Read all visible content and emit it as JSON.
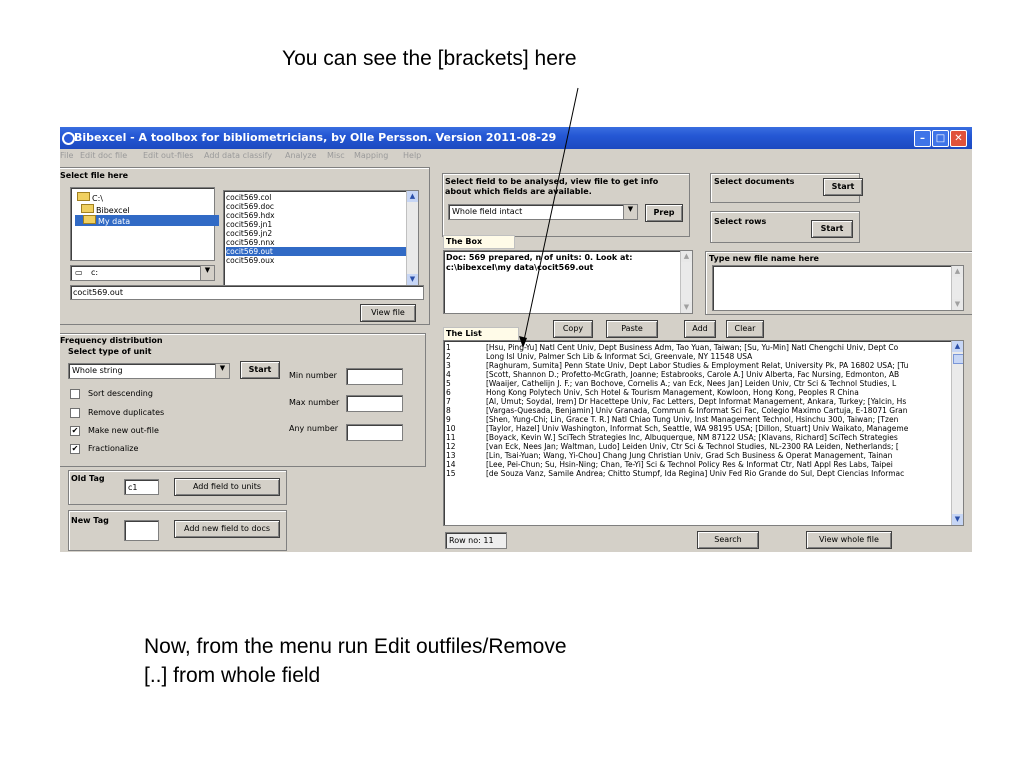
{
  "slide": {
    "top_caption": "You can see the [brackets] here",
    "bottom_caption_line1": "Now, from the menu run Edit outfiles/Remove",
    "bottom_caption_line2": "[..] from whole field"
  },
  "window": {
    "title": "Bibexcel - A toolbox for bibliometricians, by Olle Persson. Version 2011-08-29",
    "menu": [
      "File",
      "Edit doc file",
      "Edit out-files",
      "Add data classify",
      "Analyze",
      "Misc",
      "Mapping",
      "Help"
    ]
  },
  "select_file": {
    "label": "Select file here",
    "folders": [
      "C:\\",
      "Bibexcel",
      "My data"
    ],
    "files": [
      "cocit569.col",
      "cocit569.doc",
      "cocit569.hdx",
      "cocit569.jn1",
      "cocit569.jn2",
      "cocit569.nnx",
      "cocit569.out",
      "cocit569.oux"
    ],
    "selected_file": "cocit569.out",
    "drive": "c:",
    "path_value": "cocit569.out",
    "view_file_button": "View file"
  },
  "frequency": {
    "title": "Frequency distribution",
    "select_type_label": "Select type of unit",
    "unit_type": "Whole string",
    "start_button": "Start",
    "options": [
      {
        "label": "Sort descending",
        "checked": false
      },
      {
        "label": "Remove duplicates",
        "checked": false
      },
      {
        "label": "Make new out-file",
        "checked": true
      },
      {
        "label": "Fractionalize",
        "checked": true
      }
    ],
    "min_label": "Min number",
    "max_label": "Max number",
    "any_label": "Any number"
  },
  "old_tag": {
    "label": "Old Tag",
    "value": "c1",
    "button": "Add field to units"
  },
  "new_tag": {
    "label": "New Tag",
    "value": "",
    "button": "Add new field to docs"
  },
  "select_field": {
    "label_line1": "Select field to be analysed, view file to get info",
    "label_line2": "about which fields are available.",
    "field_value": "Whole field intact",
    "prep_button": "Prep"
  },
  "select_documents": {
    "label": "Select documents",
    "button": "Start"
  },
  "select_rows": {
    "label": "Select rows",
    "button": "Start"
  },
  "the_box": {
    "label": "The Box",
    "line1": "Doc: 569 prepared, n of units: 0. Look at:",
    "line2": "c:\\bibexcel\\my data\\cocit569.out"
  },
  "new_file": {
    "label": "Type new file name here",
    "value": ""
  },
  "the_list": {
    "label": "The List",
    "copy": "Copy",
    "paste": "Paste",
    "add": "Add",
    "clear": "Clear",
    "rows": [
      {
        "n": "1",
        "text": "[Hsu, Ping-Yu] Natl Cent Univ, Dept Business Adm, Tao Yuan, Taiwan; [Su, Yu-Min] Natl Chengchi Univ, Dept Co"
      },
      {
        "n": "2",
        "text": "Long Isl Univ, Palmer Sch Lib & Informat Sci, Greenvale, NY 11548 USA"
      },
      {
        "n": "3",
        "text": "[Raghuram, Sumita] Penn State Univ, Dept Labor Studies & Employment Relat, University Pk, PA 16802 USA; [Tu"
      },
      {
        "n": "4",
        "text": "[Scott, Shannon D.; Profetto-McGrath, Joanne; Estabrooks, Carole A.] Univ Alberta, Fac Nursing, Edmonton, AB"
      },
      {
        "n": "5",
        "text": "[Waaijer, Cathelijn J. F.; van Bochove, Cornelis A.; van Eck, Nees Jan] Leiden Univ, Ctr Sci & Technol Studies, L"
      },
      {
        "n": "6",
        "text": "Hong Kong Polytech Univ, Sch Hotel & Tourism Management, Kowloon, Hong Kong, Peoples R China"
      },
      {
        "n": "7",
        "text": "[Al, Umut; Soydal, Irem] Dr Hacettepe Univ, Fac Letters, Dept Informat Management, Ankara, Turkey; [Yalcin, Hs"
      },
      {
        "n": "8",
        "text": "[Vargas-Quesada, Benjamin] Univ Granada, Commun & Informat Sci Fac, Colegio Maximo Cartuja, E-18071 Gran"
      },
      {
        "n": "9",
        "text": "[Shen, Yung-Chi; Lin, Grace T. R.] Natl Chiao Tung Univ, Inst Management Technol, Hsinchu 300, Taiwan; [Tzen"
      },
      {
        "n": "10",
        "text": "[Taylor, Hazel] Univ Washington, Informat Sch, Seattle, WA 98195 USA; [Dillon, Stuart] Univ Waikato, Manageme"
      },
      {
        "n": "11",
        "text": "[Boyack, Kevin W.] SciTech Strategies Inc, Albuquerque, NM 87122 USA; [Klavans, Richard] SciTech Strategies"
      },
      {
        "n": "12",
        "text": "[van Eck, Nees Jan; Waltman, Ludo] Leiden Univ, Ctr Sci & Technol Studies, NL-2300 RA Leiden, Netherlands; ["
      },
      {
        "n": "13",
        "text": "[Lin, Tsai-Yuan; Wang, Yi-Chou] Chang Jung Christian Univ, Grad Sch Business & Operat Management, Tainan"
      },
      {
        "n": "14",
        "text": "[Lee, Pei-Chun; Su, Hsin-Ning; Chan, Te-Yi] Sci & Technol Policy Res & Informat Ctr, Natl Appl Res Labs, Taipei"
      },
      {
        "n": "15",
        "text": "[de Souza Vanz, Samile Andrea; Chitto Stumpf, Ida Regina] Univ Fed Rio Grande do Sul, Dept Ciencias Informac"
      }
    ],
    "row_no": "Row no: 11",
    "search": "Search",
    "view_whole_file": "View whole file"
  },
  "colors": {
    "titlebar": "#2457d4",
    "selection": "#316ac5",
    "window_bg": "#d4d0c8",
    "close": "#e0523a"
  }
}
